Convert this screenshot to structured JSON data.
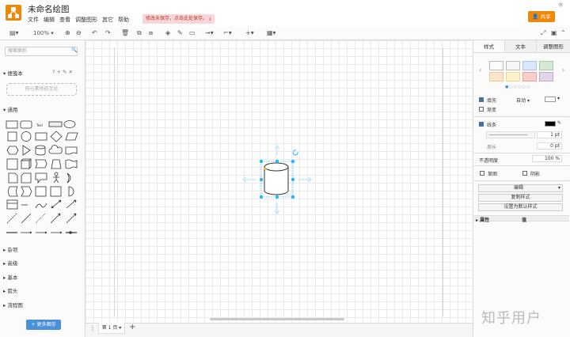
{
  "app": {
    "title": "未命名绘图",
    "save_warning": "修改未保存，点击此处保存。",
    "share": "共享"
  },
  "menu": [
    "文件",
    "编辑",
    "查看",
    "调整图形",
    "其它",
    "帮助"
  ],
  "toolbar": {
    "zoom": "100%"
  },
  "sidebar": {
    "search_placeholder": "搜索图形",
    "scratchpad": "便笺本",
    "scratchpad_hint": "拖元素拖放至此",
    "general": "通用",
    "sections": [
      "杂项",
      "高级",
      "基本",
      "箭头",
      "流程图"
    ],
    "more_shapes": "+ 更多图形"
  },
  "format": {
    "tabs": [
      "样式",
      "文本",
      "调整图形"
    ],
    "fill_label": "填充",
    "fill_value": "自动",
    "gradient_label": "渐变",
    "line_label": "线条",
    "line_width": "1 pt",
    "perimeter_label": "周长",
    "perimeter_value": "0 pt",
    "opacity_label": "不透明度",
    "opacity_value": "100 %",
    "sketch_label": "草图",
    "shadow_label": "阴影",
    "edit_label": "编辑",
    "copy_style": "复制样式",
    "set_default": "设置为默认样式",
    "prop_col": "属性",
    "val_col": "值",
    "swatches": [
      "#ffffff",
      "#f5f5f5",
      "#dae8fc",
      "#d5e8d4",
      "#ffe6cc",
      "#fff2cc",
      "#f8cecc",
      "#e1d5e7"
    ]
  },
  "pagebar": {
    "page_tab": "第 1 页"
  },
  "watermark": "知乎用户",
  "colors": {
    "accent": "#f08705",
    "selection": "#29b6f2"
  }
}
